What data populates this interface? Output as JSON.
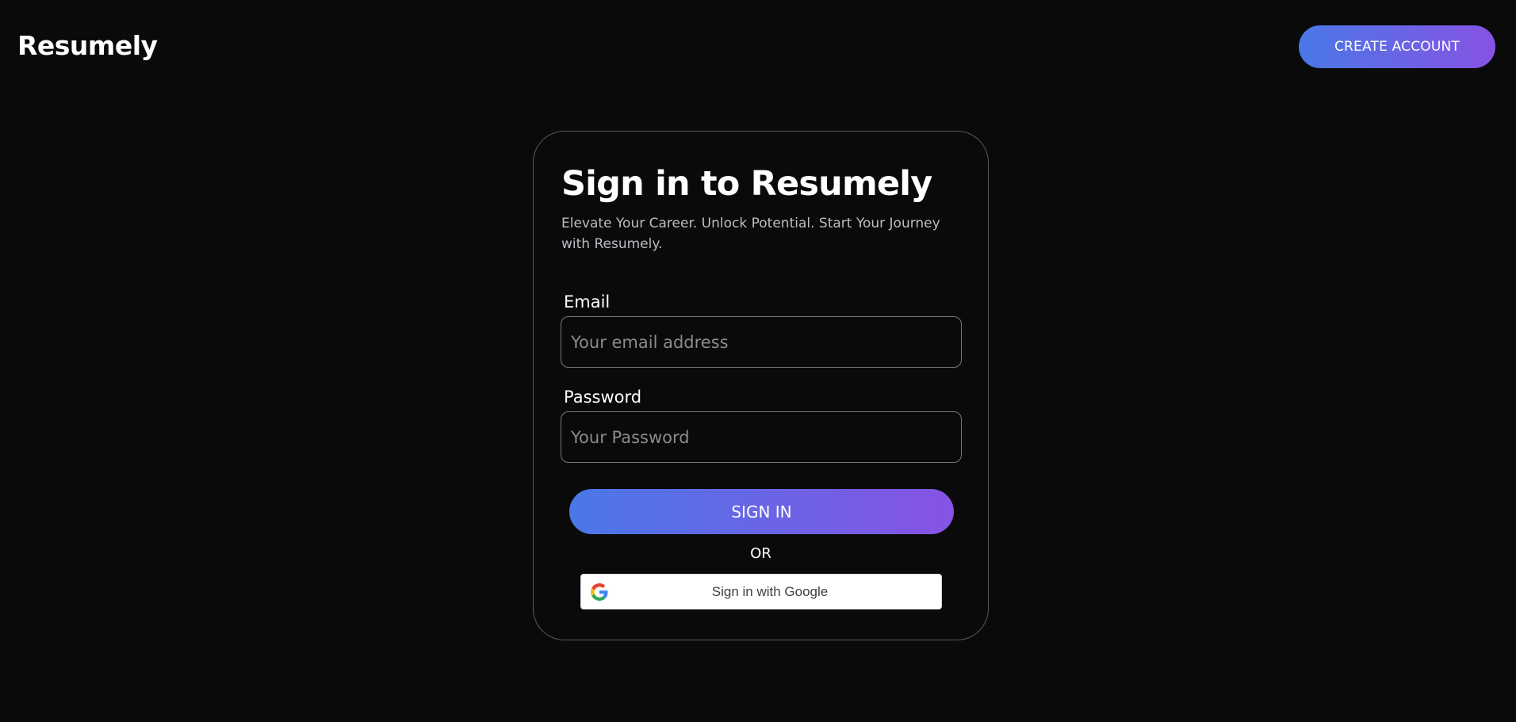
{
  "header": {
    "logo_text": "Resumely",
    "create_account_label": "CREATE ACCOUNT"
  },
  "signin_card": {
    "title": "Sign in to Resumely",
    "subtitle": "Elevate Your Career. Unlock Potential. Start Your Journey with Resumely.",
    "email": {
      "label": "Email",
      "placeholder": "Your email address",
      "value": ""
    },
    "password": {
      "label": "Password",
      "placeholder": "Your Password",
      "value": ""
    },
    "signin_label": "SIGN IN",
    "or_text": "OR",
    "google_label": "Sign in with Google",
    "google_icon": "google-g-icon"
  },
  "colors": {
    "background": "#0a0a0b",
    "accent_gradient_start": "#4a78e6",
    "accent_gradient_end": "#8753e4",
    "card_border": "#5a5a5e",
    "subtitle_text": "#bdbdc3",
    "placeholder_text": "#8b8b90"
  }
}
